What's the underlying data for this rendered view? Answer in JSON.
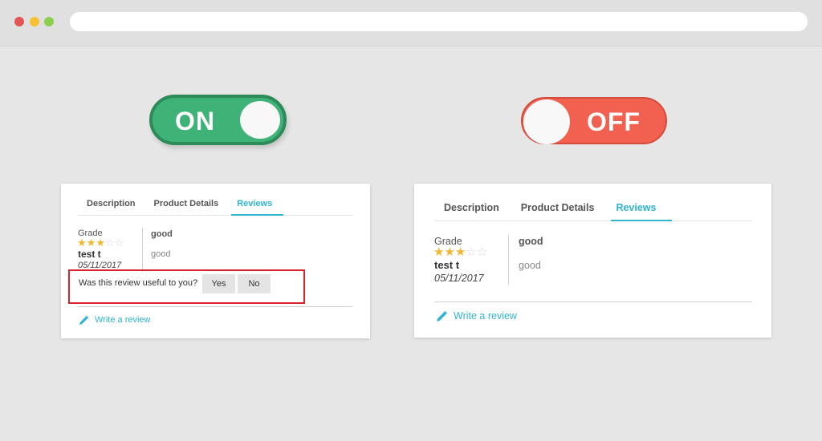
{
  "browser": {
    "dots": [
      "close",
      "minimize",
      "maximize"
    ],
    "url": ""
  },
  "toggles": {
    "on_label": "ON",
    "off_label": "OFF"
  },
  "colors": {
    "accent": "#2fb5d2",
    "on": "#3fb277",
    "off": "#f26150",
    "highlight": "#d9232d",
    "star": "#f1b72f"
  },
  "tabs": [
    "Description",
    "Product Details",
    "Reviews"
  ],
  "active_tab": "Reviews",
  "review": {
    "grade_label": "Grade",
    "rating": 3,
    "rating_max": 5,
    "author": "test t",
    "date": "05/11/2017",
    "title": "good",
    "body": "good"
  },
  "useful": {
    "question": "Was this review useful to you?",
    "yes": "Yes",
    "no": "No"
  },
  "write_review": "Write a review"
}
